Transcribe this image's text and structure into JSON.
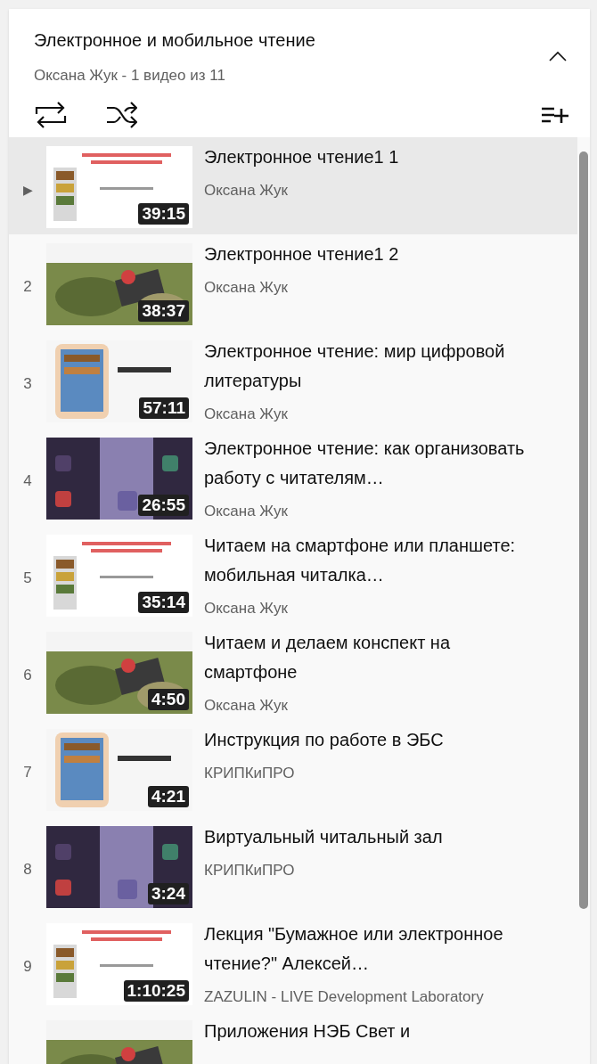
{
  "playlist": {
    "title": "Электронное и мобильное чтение",
    "subtitle": "Оксана Жук - 1 видео из 11",
    "collapse_expanded": true
  },
  "items": [
    {
      "index": "▶",
      "selected": true,
      "title": "Электронное чтение1 1",
      "channel": "Оксана Жук",
      "duration": "39:15"
    },
    {
      "index": "2",
      "selected": false,
      "title": "Электронное чтение1 2",
      "channel": "Оксана Жук",
      "duration": "38:37"
    },
    {
      "index": "3",
      "selected": false,
      "title": "Электронное чтение: мир цифровой литературы",
      "channel": "Оксана Жук",
      "duration": "57:11"
    },
    {
      "index": "4",
      "selected": false,
      "title": "Электронное чтение: как организовать работу с читателям…",
      "channel": "Оксана Жук",
      "duration": "26:55"
    },
    {
      "index": "5",
      "selected": false,
      "title": "Читаем на смартфоне или планшете: мобильная читалка…",
      "channel": "Оксана Жук",
      "duration": "35:14"
    },
    {
      "index": "6",
      "selected": false,
      "title": "Читаем и делаем конспект на смартфоне",
      "channel": "Оксана Жук",
      "duration": "4:50"
    },
    {
      "index": "7",
      "selected": false,
      "title": "Инструкция по работе в ЭБС",
      "channel": "КРИПКиПРО",
      "duration": "4:21"
    },
    {
      "index": "8",
      "selected": false,
      "title": "Виртуальный читальный зал",
      "channel": "КРИПКиПРО",
      "duration": "3:24"
    },
    {
      "index": "9",
      "selected": false,
      "title": "Лекция \"Бумажное или электронное чтение?\" Алексей…",
      "channel": "ZAZULIN - LIVE Development Laboratory",
      "duration": "1:10:25"
    },
    {
      "title": "Приложения НЭБ Свет и"
    }
  ]
}
